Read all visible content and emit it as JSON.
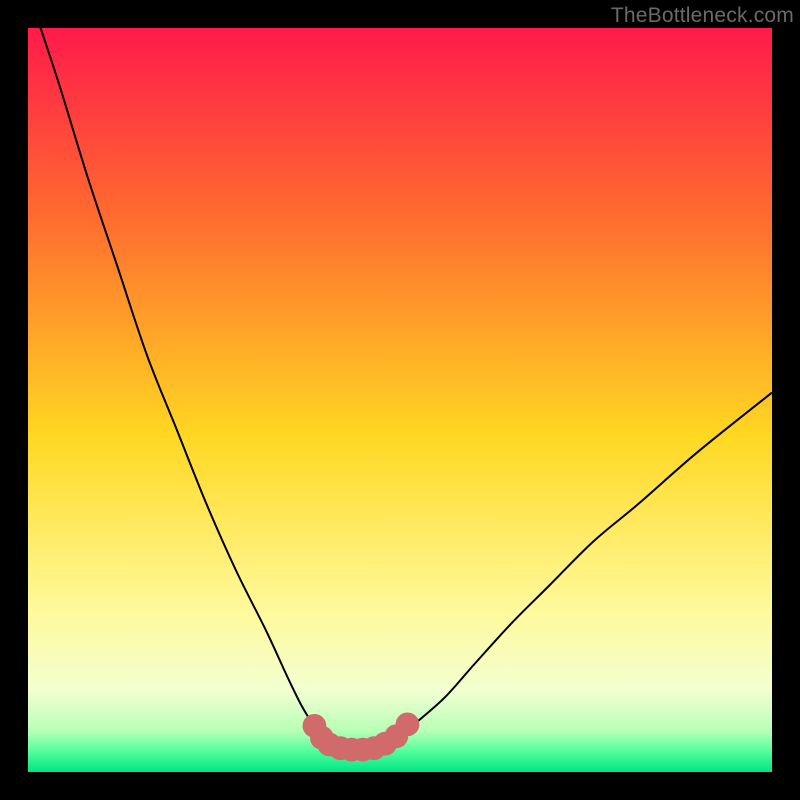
{
  "watermark": "TheBottleneck.com",
  "chart_data": {
    "type": "line",
    "title": "",
    "xlabel": "",
    "ylabel": "",
    "xlim": [
      0,
      100
    ],
    "ylim": [
      0,
      100
    ],
    "background_gradient": {
      "stops": [
        {
          "offset": 0.0,
          "color": "#ff1a4b"
        },
        {
          "offset": 0.25,
          "color": "#ff6a2f"
        },
        {
          "offset": 0.55,
          "color": "#ffd822"
        },
        {
          "offset": 0.78,
          "color": "#fff99a"
        },
        {
          "offset": 0.89,
          "color": "#f3ffd0"
        },
        {
          "offset": 0.945,
          "color": "#b7ffb7"
        },
        {
          "offset": 0.97,
          "color": "#5aff9e"
        },
        {
          "offset": 1.0,
          "color": "#00e683"
        }
      ]
    },
    "series": [
      {
        "name": "bottleneck-curve",
        "color": "#000000",
        "x": [
          0,
          4,
          8,
          12,
          16,
          20,
          24,
          28,
          32,
          35,
          37,
          39,
          40.5,
          42,
          43.5,
          45,
          47,
          49.5,
          52,
          56,
          60,
          65,
          70,
          76,
          82,
          90,
          100
        ],
        "y": [
          105,
          93,
          80,
          68,
          56,
          46,
          36,
          27,
          19,
          12.5,
          8.5,
          5.5,
          4.0,
          3.3,
          3.0,
          3.0,
          3.3,
          4.5,
          6.5,
          10,
          14.5,
          20,
          25,
          31,
          36,
          43,
          51
        ]
      },
      {
        "name": "valley-highlight",
        "color": "#d16a6a",
        "type": "scatter-line",
        "x": [
          38.5,
          39.5,
          40.5,
          42.0,
          43.5,
          45.0,
          46.5,
          48.0,
          49.5,
          51.0
        ],
        "y": [
          6.2,
          4.6,
          3.7,
          3.2,
          3.0,
          3.0,
          3.2,
          3.8,
          4.8,
          6.4
        ],
        "marker_radius": 1.6
      }
    ]
  }
}
